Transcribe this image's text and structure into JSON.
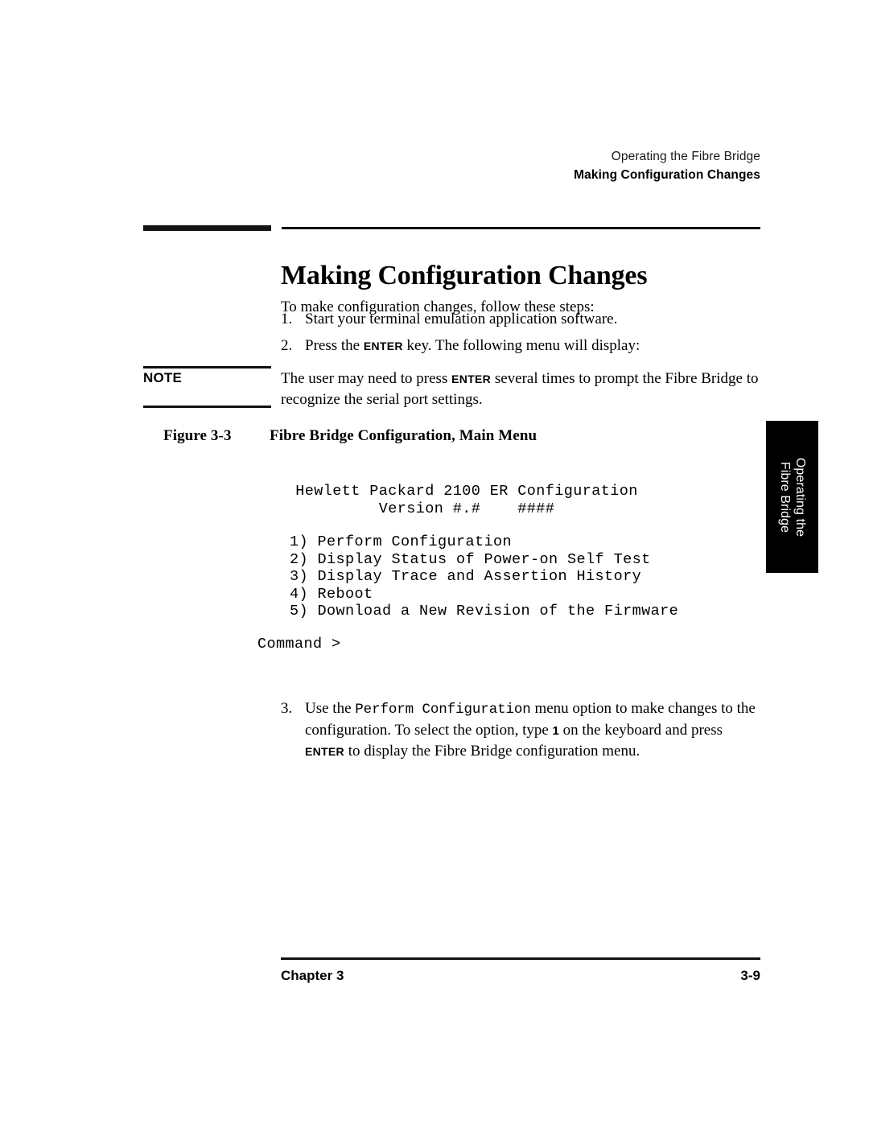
{
  "header": {
    "line1": "Operating the Fibre Bridge",
    "line2": "Making Configuration Changes"
  },
  "title": "Making Configuration Changes",
  "intro": "To make configuration changes, follow these steps:",
  "steps": [
    {
      "number": "1.",
      "text": "Start your terminal emulation application software."
    },
    {
      "number": "2.",
      "prefix": "Press the ",
      "key": "ENTER",
      "suffix": " key. The following menu will display:"
    },
    {
      "number": "3.",
      "part1": "Use the ",
      "mono1": "Perform Configuration",
      "part2": " menu option to make changes to the configuration. To select the option, type ",
      "key1": "1",
      "part3": " on the keyboard and press ",
      "key2": "ENTER",
      "part4": " to display the Fibre Bridge configuration menu."
    }
  ],
  "note": {
    "label": "NOTE",
    "body_prefix": "The user may need to press ",
    "body_key": "ENTER",
    "body_suffix": " several times to prompt the Fibre Bridge to recognize the serial port settings."
  },
  "figure": {
    "label": "Figure 3-3",
    "title": "Fibre Bridge Configuration, Main Menu"
  },
  "terminal": {
    "banner_line1": "Hewlett Packard 2100 ER Configuration",
    "banner_line2": "Version #.#    ####",
    "menu": "1) Perform Configuration\n2) Display Status of Power-on Self Test\n3) Display Trace and Assertion History\n4) Reboot\n5) Download a New Revision of the Firmware",
    "prompt": "Command >"
  },
  "side_tab": {
    "line1": "Operating the",
    "line2": "Fibre Bridge"
  },
  "footer": {
    "left": "Chapter 3",
    "right": "3-9"
  },
  "colors": {
    "text": "#000000",
    "rule": "#111111",
    "tab_background": "#000000",
    "tab_text": "#ffffff",
    "page_background": "#ffffff"
  }
}
